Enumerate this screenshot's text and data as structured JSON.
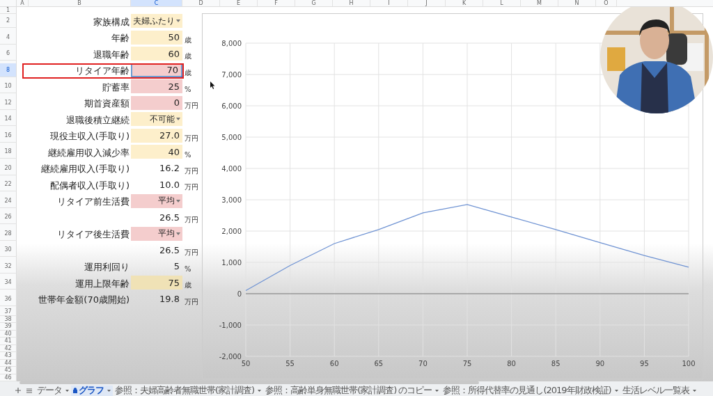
{
  "column_headers": [
    "A",
    "B",
    "C",
    "D",
    "E",
    "F",
    "G",
    "H",
    "I",
    "J",
    "K",
    "L",
    "M",
    "N",
    "O"
  ],
  "row_numbers": [
    "1",
    "2",
    "4",
    "6",
    "8",
    "10",
    "12",
    "14",
    "16",
    "18",
    "20",
    "22",
    "24",
    "26",
    "28",
    "30",
    "32",
    "34",
    "36",
    "37",
    "38",
    "39",
    "40",
    "41",
    "42",
    "43",
    "44",
    "45",
    "46"
  ],
  "inputs": [
    {
      "label": "家族構成",
      "value": "夫婦ふたり",
      "kind": "select",
      "color": "#fdefcb",
      "selected": false,
      "highlighted": false
    },
    {
      "label": "年齢",
      "value": "50",
      "unit": "歳",
      "kind": "input",
      "color": "#fdefcb",
      "selected": false,
      "highlighted": false
    },
    {
      "label": "退職年齢",
      "value": "60",
      "unit": "歳",
      "kind": "input",
      "color": "#fdefcb",
      "selected": false,
      "highlighted": false
    },
    {
      "label": "リタイア年齢",
      "value": "70",
      "unit": "歳",
      "kind": "input",
      "color": "#f4cdcd",
      "selected": true,
      "highlighted": true
    },
    {
      "label": "貯蓄率",
      "value": "25",
      "unit": "%",
      "kind": "input",
      "color": "#f4cdcd",
      "selected": false,
      "highlighted": false
    },
    {
      "label": "期首資産額",
      "value": "0",
      "unit": "万円",
      "kind": "input",
      "color": "#f4cdcd",
      "selected": false,
      "highlighted": false
    },
    {
      "label": "退職後積立継続",
      "value": "不可能",
      "kind": "select",
      "color": "#fdefcb",
      "selected": false,
      "highlighted": false
    },
    {
      "label": "現役主収入(手取り)",
      "value": "27.0",
      "unit": "万円",
      "kind": "input",
      "color": "#fdefcb",
      "selected": false,
      "highlighted": false
    },
    {
      "label": "継続雇用収入減少率",
      "value": "40",
      "unit": "%",
      "kind": "input",
      "color": "#fdefcb",
      "selected": false,
      "highlighted": false
    },
    {
      "label": "継続雇用収入(手取り)",
      "value": "16.2",
      "unit": "万円",
      "kind": "value",
      "selected": false,
      "highlighted": false
    },
    {
      "label": "配偶者収入(手取り)",
      "value": "10.0",
      "unit": "万円",
      "kind": "value",
      "selected": false,
      "highlighted": false
    },
    {
      "label": "リタイア前生活費",
      "value": "平均",
      "kind": "select",
      "color": "#f4cdcd",
      "selected": false,
      "highlighted": false
    },
    {
      "value": "26.5",
      "unit": "万円",
      "kind": "value",
      "selected": false,
      "highlighted": false
    },
    {
      "label": "リタイア後生活費",
      "value": "平均",
      "kind": "select",
      "color": "#f4cdcd",
      "selected": false,
      "highlighted": false
    },
    {
      "value": "26.5",
      "unit": "万円",
      "kind": "value",
      "selected": false,
      "highlighted": false
    },
    {
      "label": "運用利回り",
      "value": "5",
      "unit": "%",
      "kind": "value",
      "selected": false,
      "highlighted": false
    },
    {
      "label": "運用上限年齢",
      "value": "75",
      "unit": "歳",
      "kind": "input",
      "color": "#f0e2b6",
      "selected": false,
      "highlighted": false
    },
    {
      "label": "世帯年金額(70歳開始)",
      "value": "19.8",
      "unit": "万円",
      "kind": "value",
      "selected": false,
      "highlighted": false
    }
  ],
  "chart": {
    "chart_data": {
      "type": "line",
      "x": [
        50,
        55,
        60,
        65,
        70,
        75,
        80,
        85,
        90,
        95,
        100
      ],
      "series": [
        {
          "color": "#6f93d3",
          "values": [
            100,
            900,
            1600,
            2050,
            2580,
            2850,
            2450,
            2050,
            1630,
            1220,
            850
          ]
        }
      ],
      "grid": true,
      "xlim": [
        50,
        100
      ],
      "ylim": [
        -2000,
        8000
      ],
      "xticks": [
        50,
        55,
        60,
        65,
        70,
        75,
        80,
        85,
        90,
        95,
        100
      ],
      "yticks": [
        {
          "value": -2000,
          "label": "-2,000"
        },
        {
          "value": -1000,
          "label": "-1,000"
        },
        {
          "value": 0,
          "label": "0"
        },
        {
          "value": 1000,
          "label": "1,000"
        },
        {
          "value": 2000,
          "label": "2,000"
        },
        {
          "value": 3000,
          "label": "3,000"
        },
        {
          "value": 4000,
          "label": "4,000"
        },
        {
          "value": 5000,
          "label": "5,000"
        },
        {
          "value": 6000,
          "label": "6,000"
        },
        {
          "value": 7000,
          "label": "7,000"
        },
        {
          "value": 8000,
          "label": "8,000"
        }
      ]
    }
  },
  "sheet_tabs": [
    {
      "label": "データ",
      "selected": false,
      "locked": false
    },
    {
      "label": "グラフ",
      "selected": true,
      "locked": true
    },
    {
      "label": "参照：夫婦高齢者無職世帯(家計調査)",
      "selected": false,
      "locked": false
    },
    {
      "label": "参照：高齢単身無職世帯(家計調査) のコピー",
      "selected": false,
      "locked": false
    },
    {
      "label": "参照：所得代替率の見通し(2019年財政検証)",
      "selected": false,
      "locked": false
    },
    {
      "label": "生活レベル一覧表",
      "selected": false,
      "locked": false
    }
  ]
}
